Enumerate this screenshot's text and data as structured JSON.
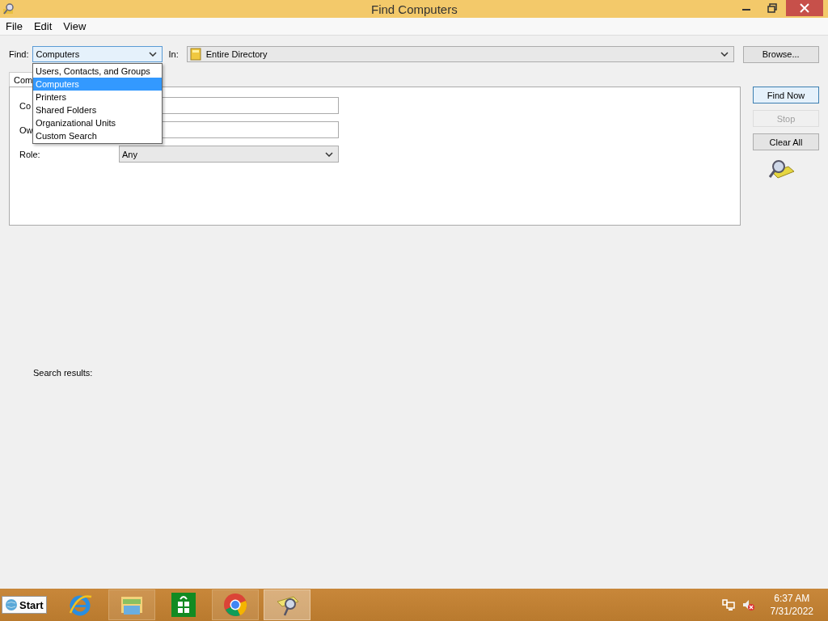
{
  "window": {
    "title": "Find Computers"
  },
  "menu": [
    "File",
    "Edit",
    "View"
  ],
  "find": {
    "label": "Find:",
    "value": "Computers",
    "expanded": true,
    "options": [
      {
        "label": "Users, Contacts, and Groups",
        "selected": false
      },
      {
        "label": "Computers",
        "selected": true
      },
      {
        "label": "Printers",
        "selected": false
      },
      {
        "label": "Shared Folders",
        "selected": false
      },
      {
        "label": "Organizational Units",
        "selected": false
      },
      {
        "label": "Custom Search",
        "selected": false
      }
    ]
  },
  "in": {
    "label": "In:",
    "value": "Entire Directory"
  },
  "browse": "Browse...",
  "tab": {
    "label": "Com"
  },
  "fields": [
    {
      "kind": "text",
      "label": "Co"
    },
    {
      "kind": "text",
      "label": "Ow"
    },
    {
      "kind": "select",
      "label": "Role:",
      "value": "Any"
    }
  ],
  "buttons": [
    {
      "label": "Find Now",
      "default": true,
      "disabled": false
    },
    {
      "label": "Stop",
      "default": false,
      "disabled": true
    },
    {
      "label": "Clear All",
      "default": false,
      "disabled": false
    }
  ],
  "results_label": "Search results:",
  "taskbar": {
    "start": "Start",
    "apps": [
      {
        "kind": "ie",
        "running": false,
        "selected": false
      },
      {
        "kind": "folder",
        "running": true,
        "selected": false
      },
      {
        "kind": "store",
        "running": false,
        "selected": false
      },
      {
        "kind": "chrome",
        "running": true,
        "selected": false
      },
      {
        "kind": "find",
        "running": true,
        "selected": true
      }
    ],
    "time": "6:37 AM",
    "date": "7/31/2022"
  }
}
